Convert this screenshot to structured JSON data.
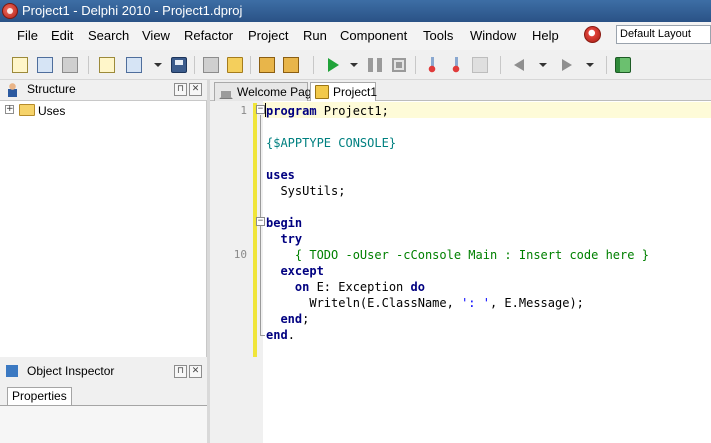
{
  "window": {
    "title": "Project1 - Delphi 2010 - Project1.dproj"
  },
  "menu": {
    "items": [
      "File",
      "Edit",
      "Search",
      "View",
      "Refactor",
      "Project",
      "Run",
      "Component",
      "Tools",
      "Window",
      "Help"
    ],
    "layout_value": "Default Layout"
  },
  "structure": {
    "title": "Structure",
    "tree": [
      {
        "label": "Uses"
      }
    ]
  },
  "object_inspector": {
    "title": "Object Inspector",
    "tab": "Properties"
  },
  "editor": {
    "tabs": [
      {
        "label": "Welcome Page"
      },
      {
        "label": "Project1"
      }
    ],
    "line_numbers": [
      {
        "line": 1,
        "text": "1"
      },
      {
        "line": 10,
        "text": "10"
      }
    ],
    "lines": [
      [
        {
          "t": "kw",
          "v": "program"
        },
        {
          "t": "",
          "v": " Project1;"
        }
      ],
      [],
      [
        {
          "t": "dir",
          "v": "{$APPTYPE CONSOLE}"
        }
      ],
      [],
      [
        {
          "t": "kw",
          "v": "uses"
        }
      ],
      [
        {
          "t": "",
          "v": "  SysUtils;"
        }
      ],
      [],
      [
        {
          "t": "kw",
          "v": "begin"
        }
      ],
      [
        {
          "t": "",
          "v": "  "
        },
        {
          "t": "kw",
          "v": "try"
        }
      ],
      [
        {
          "t": "",
          "v": "    "
        },
        {
          "t": "cmt",
          "v": "{ TODO -oUser -cConsole Main : Insert code here }"
        }
      ],
      [
        {
          "t": "",
          "v": "  "
        },
        {
          "t": "kw",
          "v": "except"
        }
      ],
      [
        {
          "t": "",
          "v": "    "
        },
        {
          "t": "kw",
          "v": "on"
        },
        {
          "t": "",
          "v": " E: Exception "
        },
        {
          "t": "kw",
          "v": "do"
        }
      ],
      [
        {
          "t": "",
          "v": "      Writeln(E.ClassName, "
        },
        {
          "t": "str",
          "v": "': '"
        },
        {
          "t": "",
          "v": ", E.Message);"
        }
      ],
      [
        {
          "t": "",
          "v": "  "
        },
        {
          "t": "kw",
          "v": "end"
        },
        {
          "t": "",
          "v": ";"
        }
      ],
      [
        {
          "t": "kw",
          "v": "end"
        },
        {
          "t": "",
          "v": "."
        }
      ]
    ]
  }
}
